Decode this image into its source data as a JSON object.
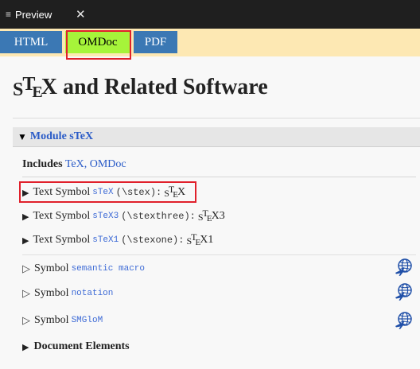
{
  "editor_tab": {
    "menu_icon": "≡",
    "title": "Preview",
    "close": "✕"
  },
  "format_tabs": [
    {
      "label": "HTML",
      "active": false
    },
    {
      "label": "OMDoc",
      "active": true
    },
    {
      "label": "PDF",
      "active": false
    }
  ],
  "title": {
    "logo": {
      "s": "S",
      "t": "T",
      "e": "E",
      "x": "X"
    },
    "rest": " and Related Software"
  },
  "module": {
    "label": "Module sTeX"
  },
  "includes": {
    "label": "Includes",
    "links": "TeX, OMDoc"
  },
  "text_symbols": [
    {
      "prefix": "Text Symbol",
      "name": "sTeX",
      "macro": "(\\stex):",
      "render_suffix": ""
    },
    {
      "prefix": "Text Symbol",
      "name": "sTeX3",
      "macro": "(\\stexthree):",
      "render_suffix": "3"
    },
    {
      "prefix": "Text Symbol",
      "name": "sTeX1",
      "macro": "(\\stexone):",
      "render_suffix": "1"
    }
  ],
  "symbols": [
    {
      "prefix": "Symbol",
      "name": "semantic macro"
    },
    {
      "prefix": "Symbol",
      "name": "notation"
    },
    {
      "prefix": "Symbol",
      "name": "SMGloM"
    }
  ],
  "document_elements": {
    "label": "Document Elements"
  },
  "colors": {
    "tab_blue": "#3b78b4",
    "tab_active": "#a6f43a",
    "format_bar": "#fde8b3",
    "link": "#2a5bc7",
    "highlight": "#e0202b"
  }
}
